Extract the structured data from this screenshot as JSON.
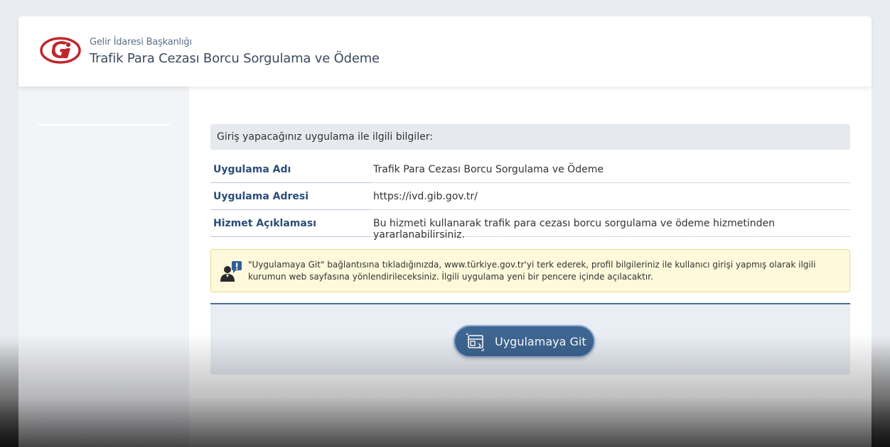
{
  "header": {
    "org_name": "Gelir İdaresi Başkanlığı",
    "app_title": "Trafik Para Cezası Borcu Sorgulama ve Ödeme",
    "logo_icon": "gib-logo"
  },
  "info": {
    "header": "Giriş yapacağınız uygulama ile ilgili bilgiler:",
    "rows": [
      {
        "label": "Uygulama Adı",
        "value": "Trafik Para Cezası Borcu Sorgulama ve Ödeme"
      },
      {
        "label": "Uygulama Adresi",
        "value": "https://ivd.gib.gov.tr/"
      },
      {
        "label": "Hizmet Açıklaması",
        "value": "Bu hizmeti kullanarak trafik para cezası borcu sorgulama ve ödeme hizmetinden yararlanabilirsiniz."
      }
    ]
  },
  "notice": {
    "icon": "user-alert-icon",
    "text": "\"Uygulamaya Git\" bağlantısına tıkladığınızda, www.türkiye.gov.tr'yi terk ederek, profil bilgileriniz ile kullanıcı girişi yapmış olarak ilgili kurumun web sayfasına yönlendirileceksiniz. İlgili uygulama yeni bir pencere içinde açılacaktır."
  },
  "action": {
    "button_label": "Uygulamaya Git",
    "button_icon": "external-window-icon"
  },
  "colors": {
    "accent": "#3e6692",
    "label": "#2a4d7a",
    "logo_red": "#c0272d",
    "notice_bg": "#fdf9da"
  }
}
